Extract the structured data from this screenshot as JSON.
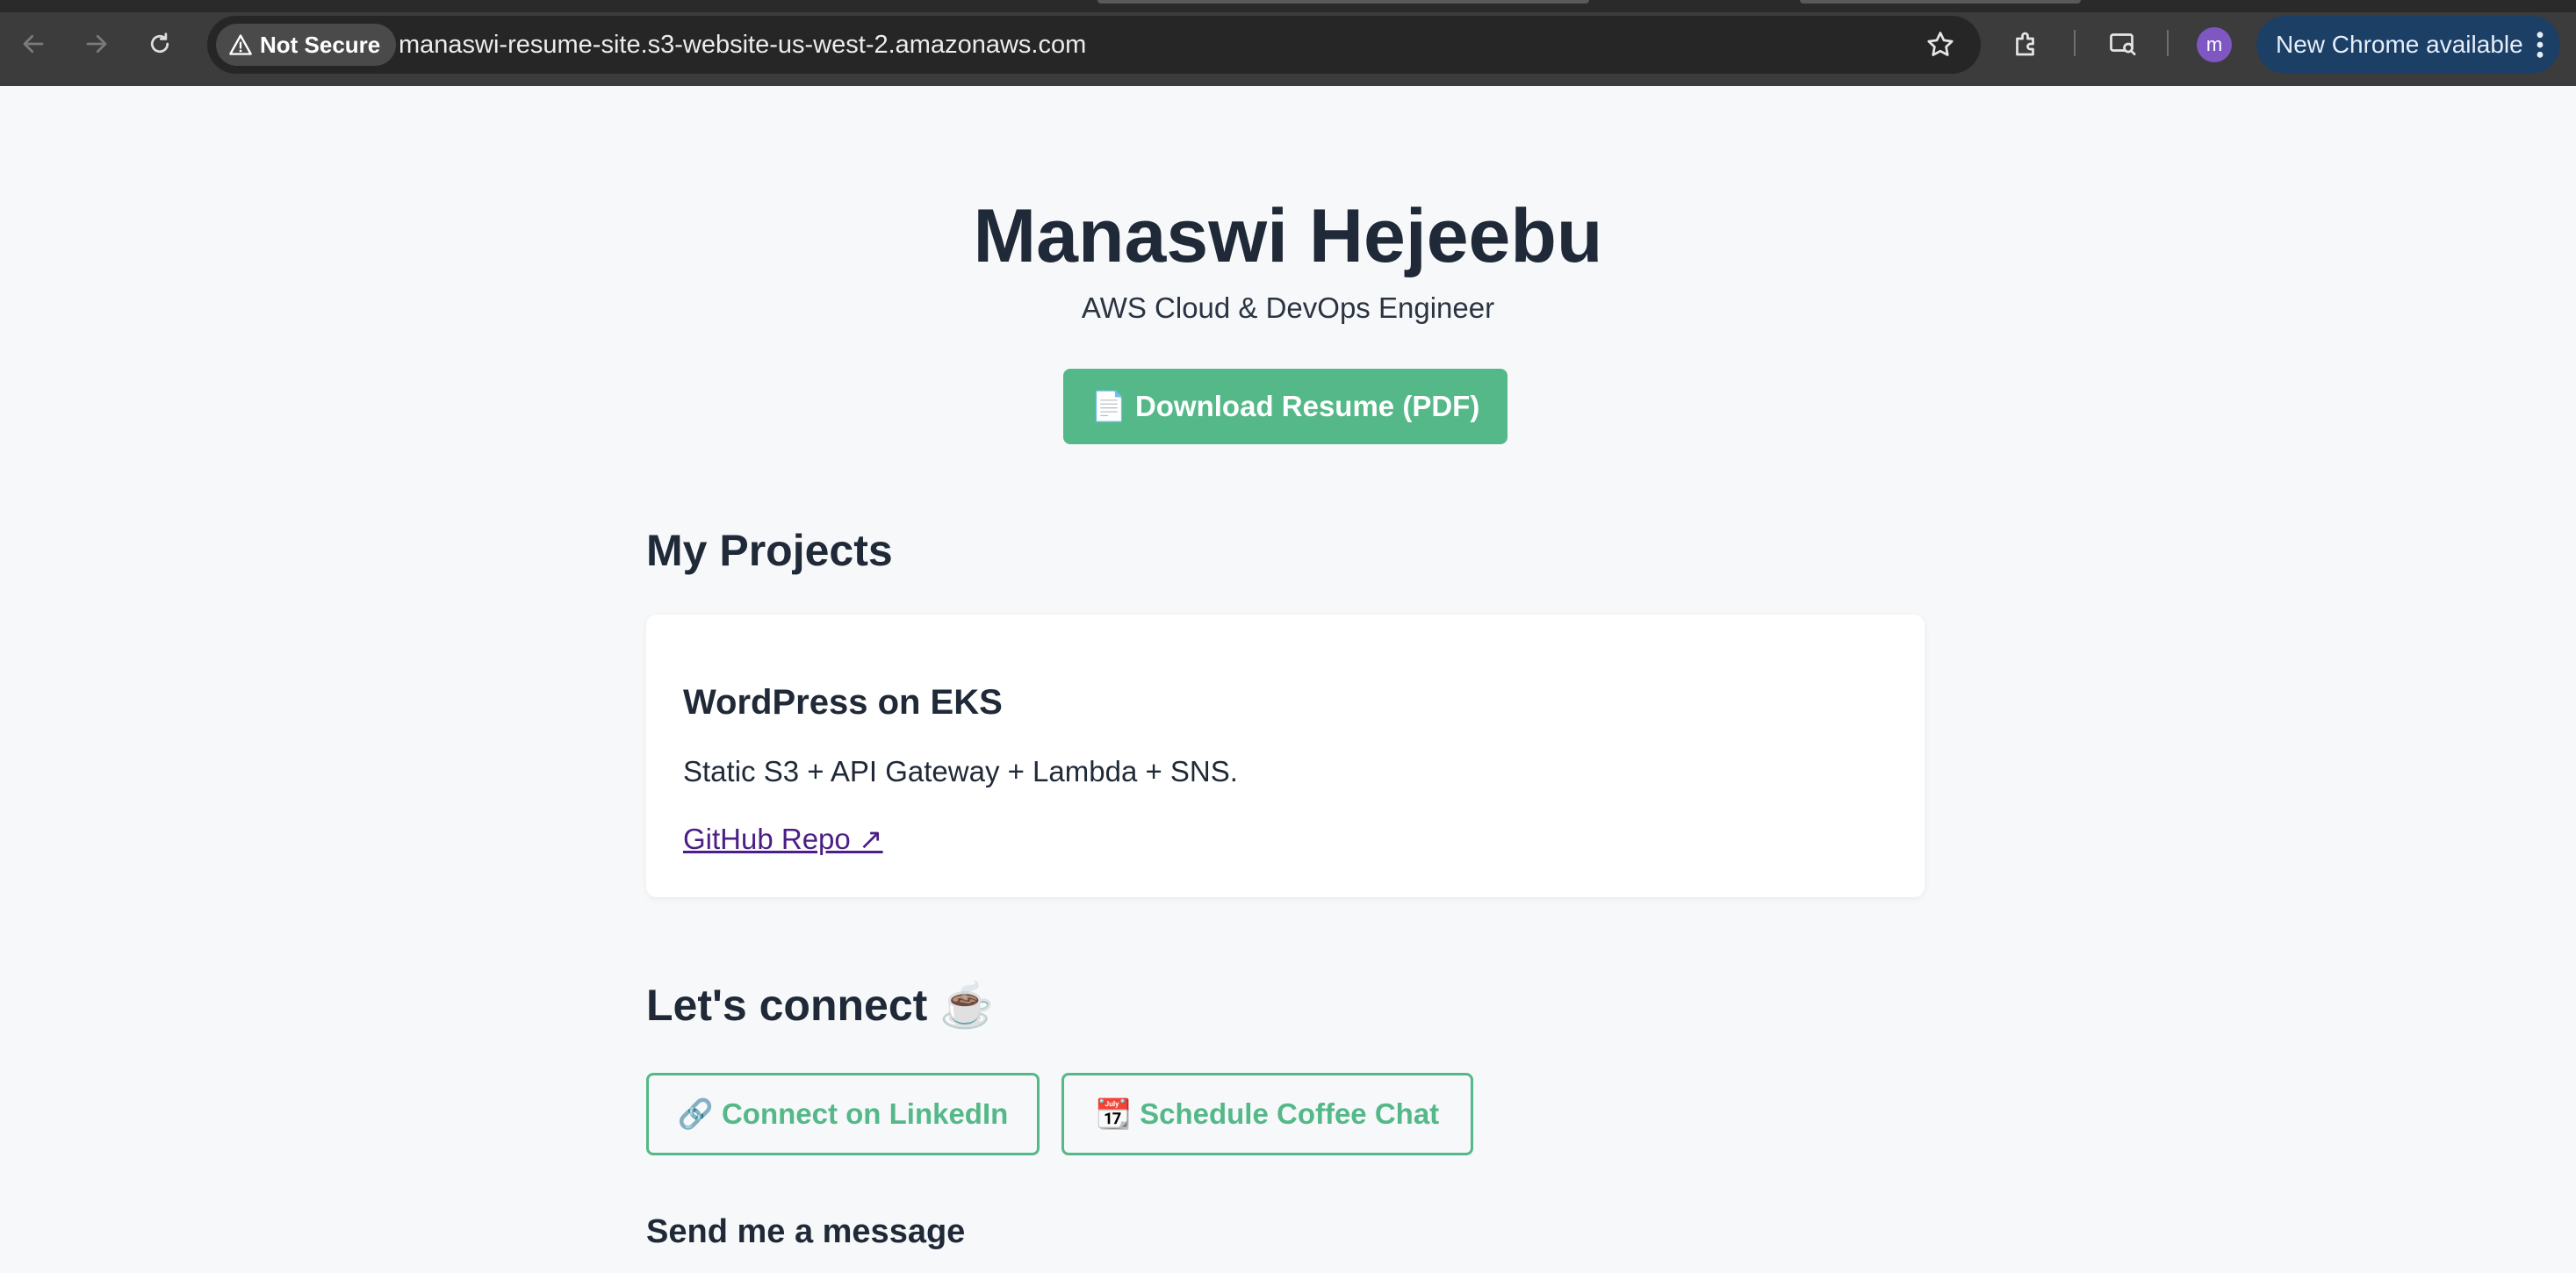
{
  "browser": {
    "security_label": "Not Secure",
    "url": "manaswi-resume-site.s3-website-us-west-2.amazonaws.com",
    "avatar_letter": "m",
    "update_label": "New Chrome available",
    "icons": [
      "back-icon",
      "forward-icon",
      "reload-icon",
      "warning-icon",
      "star-icon",
      "extensions-icon",
      "tab-search-icon",
      "menu-icon"
    ]
  },
  "header": {
    "name": "Manaswi Hejeebu",
    "tagline": "AWS Cloud & DevOps Engineer",
    "download_label": "📄 Download Resume (PDF)"
  },
  "projects": {
    "heading": "My Projects",
    "items": [
      {
        "title": "WordPress on EKS",
        "description": "Static S3 + API Gateway + Lambda + SNS.",
        "link_label": "GitHub Repo ↗"
      }
    ]
  },
  "connect": {
    "heading": "Let's connect ☕",
    "linkedin_label": "🔗 Connect on LinkedIn",
    "coffee_label": "📆 Schedule Coffee Chat",
    "message_heading": "Send me a message"
  },
  "colors": {
    "accent": "#55b888",
    "text": "#1f2937",
    "link": "#4b1f86",
    "page_bg": "#f7f8fa"
  }
}
